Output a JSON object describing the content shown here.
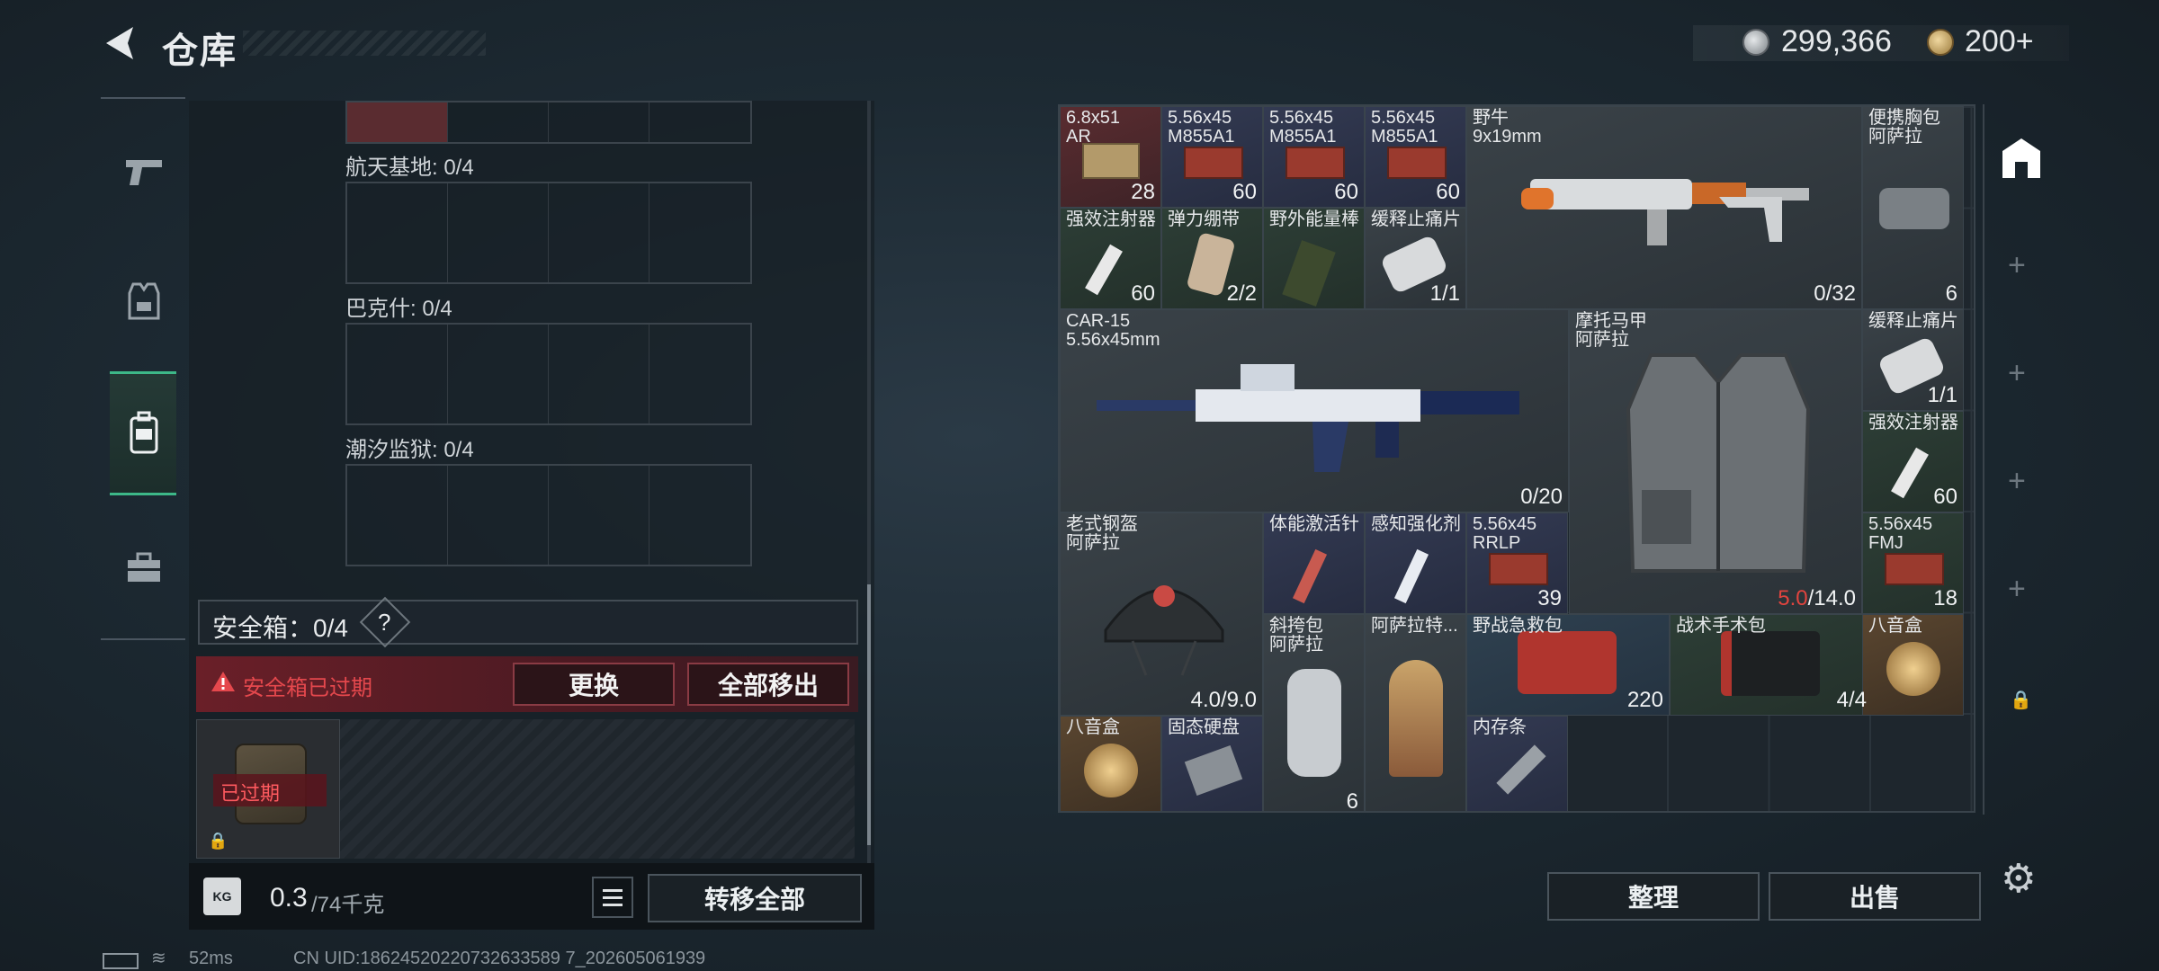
{
  "header": {
    "title": "仓库"
  },
  "currency": {
    "silver": "299,366",
    "gold": "200+"
  },
  "left_panel": {
    "locations": [
      {
        "label": "航天基地: 0/4"
      },
      {
        "label": "巴克什: 0/4"
      },
      {
        "label": "潮汐监狱: 0/4"
      }
    ],
    "safebox_label": "安全箱：0/4",
    "help": "?",
    "expired_notice": "安全箱已过期",
    "replace_button": "更换",
    "remove_all_button": "全部移出",
    "expired_badge": "已过期",
    "weight": "0.3",
    "weight_max": "/74千克",
    "transfer_all_button": "转移全部"
  },
  "grid": {
    "items": [
      {
        "name": "6.8x51\nAR",
        "count": "28",
        "color": "#5a2c30"
      },
      {
        "name": "5.56x45\nM855A1",
        "count": "60",
        "color": "#333a52"
      },
      {
        "name": "5.56x45\nM855A1",
        "count": "60",
        "color": "#333a52"
      },
      {
        "name": "5.56x45\nM855A1",
        "count": "60",
        "color": "#333a52"
      },
      {
        "name": "野牛\n9x19mm",
        "count": "0/32"
      },
      {
        "name": "便携胸包\n阿萨拉",
        "count": "6"
      },
      {
        "name": "强效注射器",
        "count": "60"
      },
      {
        "name": "弹力绷带",
        "count": "2/2"
      },
      {
        "name": "野外能量棒",
        "count": ""
      },
      {
        "name": "缓释止痛片",
        "count": "1/1"
      },
      {
        "name": "CAR-15\n5.56x45mm",
        "count": "0/20"
      },
      {
        "name": "摩托马甲\n阿萨拉",
        "count_red": "5.0",
        "count": "/14.0"
      },
      {
        "name": "缓释止痛片",
        "count": "1/1"
      },
      {
        "name": "强效注射器",
        "count": "60"
      },
      {
        "name": "老式钢盔\n阿萨拉",
        "count": "4.0/9.0"
      },
      {
        "name": "体能激活针",
        "count": ""
      },
      {
        "name": "感知强化剂",
        "count": ""
      },
      {
        "name": "5.56x45\nRRLP",
        "count": "39"
      },
      {
        "name": "5.56x45\nFMJ",
        "count": "18"
      },
      {
        "name": "斜挎包\n阿萨拉",
        "count": "6"
      },
      {
        "name": "阿萨拉特...",
        "count": ""
      },
      {
        "name": "野战急救包",
        "count": "220"
      },
      {
        "name": "战术手术包",
        "count": "4/4"
      },
      {
        "name": "八音盒",
        "count": ""
      },
      {
        "name": "八音盒",
        "count": ""
      },
      {
        "name": "固态硬盘",
        "count": ""
      },
      {
        "name": "内存条",
        "count": ""
      }
    ]
  },
  "actions": {
    "sort": "整理",
    "sell": "出售"
  },
  "status": {
    "ping": "52ms",
    "uid": "CN UID:18624520220732633589 7_202605061939"
  }
}
